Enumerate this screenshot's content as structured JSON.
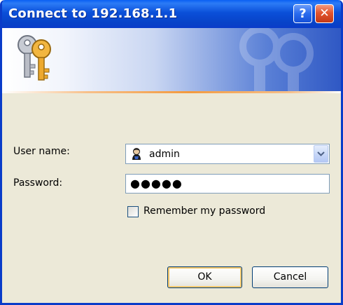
{
  "window": {
    "title": "Connect to 192.168.1.1",
    "help_button": "?",
    "close_button": "✕"
  },
  "form": {
    "username_label": "User name:",
    "username_value": "admin",
    "password_label": "Password:",
    "password_masked": "●●●●●",
    "remember_label": "Remember my password",
    "remember_checked": false
  },
  "buttons": {
    "ok": "OK",
    "cancel": "Cancel"
  },
  "icons": {
    "banner": "keys-icon",
    "username": "user-icon",
    "dropdown": "chevron-down-icon"
  },
  "colors": {
    "titlebar": "#0A4FD9",
    "window_bg": "#ECE9D8",
    "close_button": "#E2552F",
    "banner_accent": "#F39A3E"
  }
}
